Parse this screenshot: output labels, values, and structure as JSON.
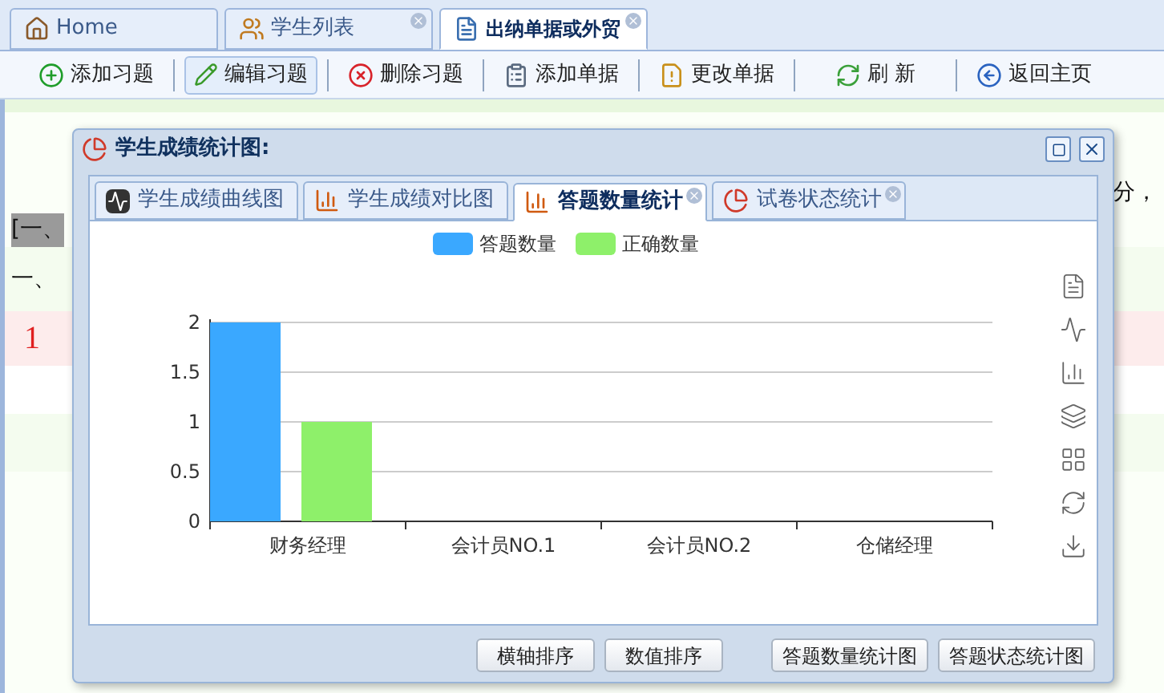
{
  "tabs": [
    {
      "label": "Home",
      "closable": false,
      "selected": false
    },
    {
      "label": "学生列表",
      "closable": true,
      "selected": false
    },
    {
      "label": "出纳单据或外贸",
      "closable": true,
      "selected": true
    }
  ],
  "toolbar": [
    {
      "label": "添加习题",
      "selected": false
    },
    {
      "label": "编辑习题",
      "selected": true
    },
    {
      "label": "删除习题",
      "selected": false
    },
    {
      "label": "添加单据",
      "selected": false
    },
    {
      "label": "更改单据",
      "selected": false
    },
    {
      "label": "刷 新",
      "selected": false
    },
    {
      "label": "返回主页",
      "selected": false
    }
  ],
  "page_text": [
    {
      "text": "分，",
      "kind": "plain"
    },
    {
      "text": "[一、",
      "kind": "highlight"
    },
    {
      "text": "一、",
      "kind": "plain"
    },
    {
      "text": "1",
      "kind": "number"
    }
  ],
  "dialog": {
    "title": "学生成绩统计图:",
    "tabs": [
      {
        "label": "学生成绩曲线图",
        "closable": false,
        "selected": false
      },
      {
        "label": "学生成绩对比图",
        "closable": false,
        "selected": false
      },
      {
        "label": "答题数量统计",
        "closable": true,
        "selected": true
      },
      {
        "label": "试卷状态统计",
        "closable": true,
        "selected": false
      }
    ],
    "chart_data": {
      "type": "bar",
      "legend": "top",
      "grid": true,
      "categories": [
        "财务经理",
        "会计员NO.1",
        "会计员NO.2",
        "仓储经理"
      ],
      "series": [
        {
          "name": "答题数量",
          "color": "#3aa8ff",
          "values": [
            2,
            0,
            0,
            0
          ]
        },
        {
          "name": "正确数量",
          "color": "#8ef06a",
          "values": [
            1,
            0,
            0,
            0
          ]
        }
      ],
      "ylim": [
        0,
        2
      ],
      "yticks": [
        0,
        0.5,
        1,
        1.5,
        2
      ]
    },
    "buttons": [
      "横轴排序",
      "数值排序",
      "答题数量统计图",
      "答题状态统计图"
    ]
  }
}
